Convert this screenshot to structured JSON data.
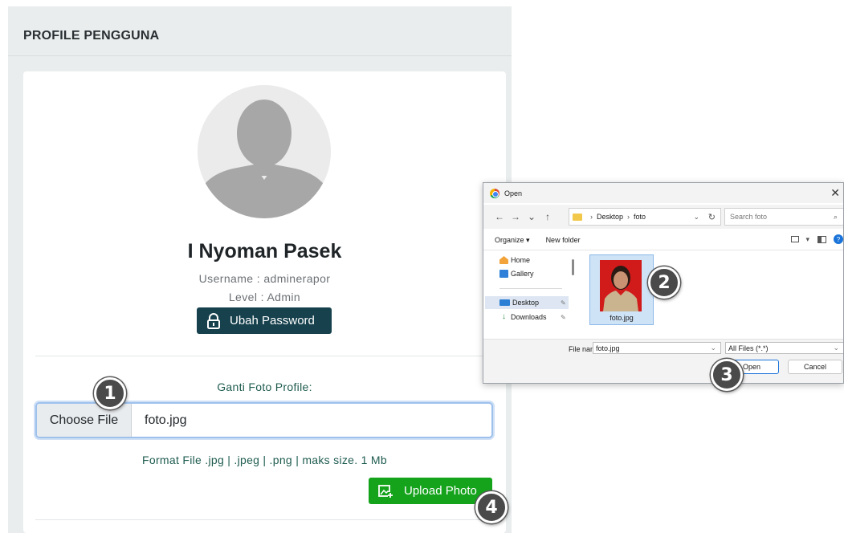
{
  "panel": {
    "title": "PROFILE PENGGUNA"
  },
  "profile": {
    "name": "I Nyoman Pasek",
    "username": "Username : adminerapor",
    "level": "Level : Admin",
    "change_password_label": "Ubah Password"
  },
  "upload": {
    "section_label": "Ganti Foto Profile:",
    "choose_file_label": "Choose File",
    "file_name": "foto.jpg",
    "format_note": "Format File .jpg | .jpeg | .png | maks size. 1 Mb",
    "upload_button_label": "Upload Photo"
  },
  "steps": [
    "1",
    "2",
    "3",
    "4"
  ],
  "dialog": {
    "title": "Open",
    "breadcrumb": [
      "Desktop",
      "foto"
    ],
    "search_placeholder": "Search foto",
    "toolbar": {
      "organize": "Organize",
      "new_folder": "New folder"
    },
    "nav_items": [
      {
        "label": "Home",
        "icon": "home-icon"
      },
      {
        "label": "Gallery",
        "icon": "gallery-icon"
      },
      {
        "label": "Desktop",
        "icon": "desktop-icon"
      },
      {
        "label": "Downloads",
        "icon": "downloads-icon"
      }
    ],
    "file": {
      "name": "foto.jpg"
    },
    "file_name_label": "File name:",
    "file_name_value": "foto.jpg",
    "file_type": "All Files (*.*)",
    "open_label": "Open",
    "cancel_label": "Cancel"
  },
  "colors": {
    "primary_dark": "#16414d",
    "success": "#15a31c",
    "accent_text": "#1e5c4f",
    "panel_bg": "#e9eded"
  }
}
